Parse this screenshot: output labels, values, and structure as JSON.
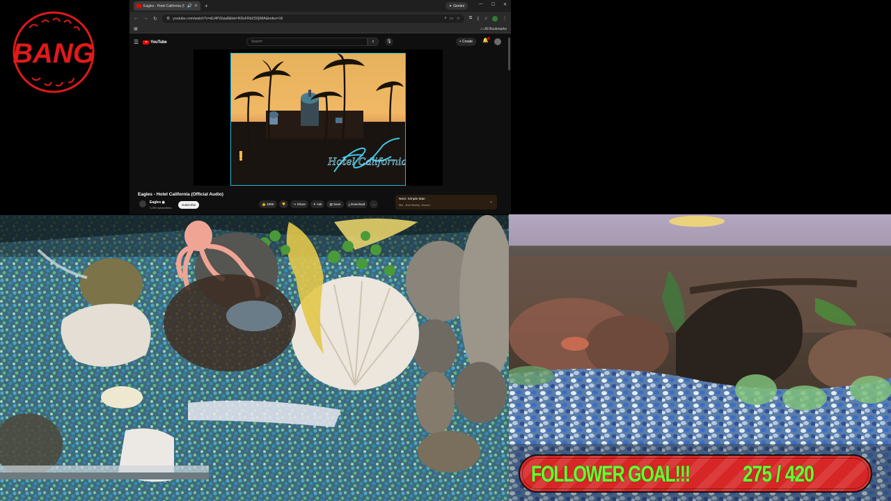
{
  "logo": {
    "text": "BANG",
    "color": "#e11919"
  },
  "browser": {
    "tab_title": "Eagles - Hotel California (C",
    "gemini_label": "Gemini",
    "url": "youtube.com/watch?v=dLl4PZtsia8&list=RDsFRbZ3XjWlA&index=16",
    "all_bookmarks": "All Bookmarks"
  },
  "youtube": {
    "logo_text": "YouTube",
    "search_placeholder": "Search",
    "create_label": "Create",
    "video_title": "Eagles - Hotel California (Official Audio)",
    "channel_name": "Eagles",
    "channel_subs": "1,050 subscribers",
    "subscribe_label": "Subscribe",
    "actions": {
      "like": "339K",
      "share": "Share",
      "ask": "Ask",
      "save": "Save",
      "download": "Download",
      "more": "..."
    },
    "next_up_title": "Next: Simple Man",
    "next_up_sub": "Mix - Bob Marley, Jensen"
  },
  "album_art": {
    "script": "Hotel California"
  },
  "follower_goal": {
    "label": "FOLLOWER GOAL!!!",
    "current": "275",
    "separator": "/",
    "target": "420",
    "progress_fraction": 0.655,
    "bar_color": "#d72626",
    "text_color": "#66ff33"
  }
}
